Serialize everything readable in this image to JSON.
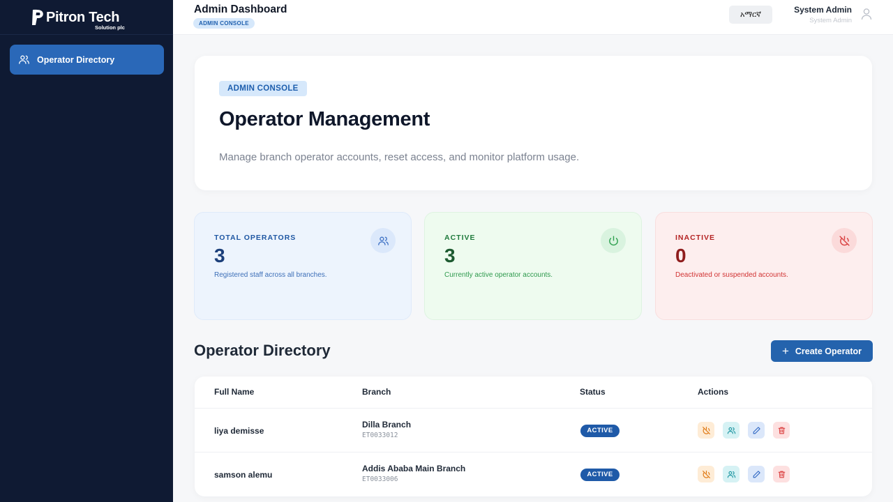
{
  "sidebar": {
    "logo": {
      "name": "Pitron Tech",
      "subtitle": "Solution plc"
    },
    "items": [
      {
        "label": "Operator Directory",
        "icon": "users-icon",
        "active": true
      }
    ]
  },
  "topbar": {
    "title": "Admin Dashboard",
    "badge": "ADMIN CONSOLE",
    "language_button": "አማርኛ",
    "user": {
      "name": "System Admin",
      "role": "System Admin",
      "icon": "user-icon"
    }
  },
  "hero": {
    "badge": "ADMIN CONSOLE",
    "title": "Operator Management",
    "subtitle": "Manage branch operator accounts, reset access, and monitor platform usage."
  },
  "stats": [
    {
      "label": "TOTAL OPERATORS",
      "value": "3",
      "description": "Registered staff across all branches.",
      "icon": "users-icon",
      "color": "#1f57a3"
    },
    {
      "label": "ACTIVE",
      "value": "3",
      "description": "Currently active operator accounts.",
      "icon": "power-icon",
      "color": "#1f7a3c"
    },
    {
      "label": "INACTIVE",
      "value": "0",
      "description": "Deactivated or suspended accounts.",
      "icon": "power-off-icon",
      "color": "#b42323"
    }
  ],
  "directory": {
    "title": "Operator Directory",
    "create_button": "Create Operator",
    "columns": [
      "Full Name",
      "Branch",
      "Status",
      "Actions"
    ],
    "rows": [
      {
        "name": "liya demisse",
        "branch": "Dilla Branch",
        "code": "ET0033012",
        "status": "ACTIVE"
      },
      {
        "name": "samson alemu",
        "branch": "Addis Ababa Main Branch",
        "code": "ET0033006",
        "status": "ACTIVE"
      }
    ]
  },
  "colors": {
    "sidebar_bg": "#0f1a33",
    "accent": "#2463ad",
    "status_active": "#1f5aa8"
  }
}
